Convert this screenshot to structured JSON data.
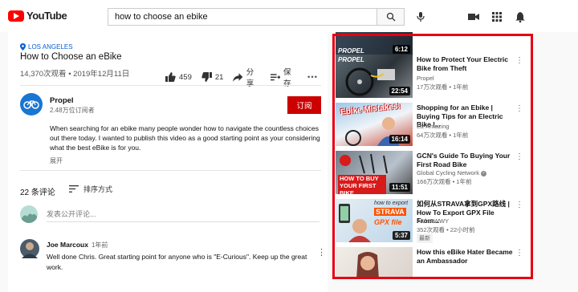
{
  "header": {
    "logo_text": "YouTube",
    "search_query": "how to choose an ebike"
  },
  "video": {
    "location": "LOS ANGELES",
    "title": "How to Choose an eBike",
    "views_date": "14,370次观看 • 2019年12月11日",
    "likes": "459",
    "dislikes": "21",
    "share_label": "分享",
    "save_label": "保存",
    "more_label": "•••"
  },
  "channel": {
    "name": "Propel",
    "subscribers": "2.48万位订阅者",
    "subscribe_label": "订阅",
    "description": "When searching for an ebike many people wonder how to navigate the countless choices out there today. I wanted to publish this video as a good starting point as your considering what the best eBike is for you.",
    "show_more": "展开"
  },
  "comments": {
    "count_label": "22 条评论",
    "sort_label": "排序方式",
    "add_placeholder": "发表公开评论...",
    "items": [
      {
        "author": "Joe Marcoux",
        "time": "1年前",
        "text": "Well done Chris. Great starting point for anyone who is \"E-Curious\". Keep up the great work."
      }
    ]
  },
  "sidebar": {
    "top_partial_duration": "6:12",
    "top_partial_caption": "PROPEL",
    "items": [
      {
        "title": "How to Protect Your Electric Bike from Theft",
        "channel": "Propel",
        "meta": "17万次观看 • 1年前",
        "duration": "22:54",
        "thumb_caption": "PROPEL"
      },
      {
        "title": "Shopping for an Ebike | Buying Tips for an Electric Bike |...",
        "channel": "Liz Amazing",
        "meta": "64万次观看 • 1年前",
        "duration": "16:14",
        "thumb_caption": "Ebike Mistakes!"
      },
      {
        "title": "GCN's Guide To Buying Your First Road Bike",
        "channel": "Global Cycling Network",
        "meta": "166万次观看 • 1年前",
        "duration": "11:51",
        "thumb_caption": "HOW TO BUY YOUR FIRST BIKE"
      },
      {
        "title": "如何从STRAVA拿到GPX路线 | How To Export GPX File From...",
        "channel": "AlvinAWWY",
        "meta": "352次观看 • 22小时前",
        "badge": "最新",
        "duration": "5:37",
        "thumb_caption_1": "how to export",
        "thumb_caption_2": "STRAVA",
        "thumb_caption_3": "GPX file"
      },
      {
        "title": "How this eBike Hater Became an Ambassador",
        "channel": "",
        "meta": ""
      }
    ]
  },
  "colors": {
    "brand_red": "#ff0000",
    "subscribe_red": "#cc0000",
    "highlight_border": "#e60012",
    "link_blue": "#065fd4"
  }
}
